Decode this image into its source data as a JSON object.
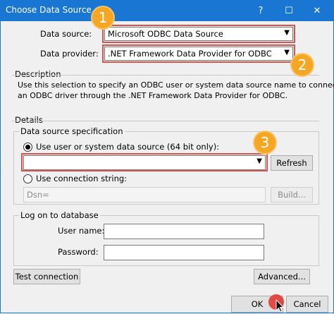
{
  "window": {
    "title": "Choose Data Source",
    "help": "?",
    "maximize": "☐",
    "close": "✕"
  },
  "data_source": {
    "label": "Data source:",
    "value": "Microsoft ODBC Data Source"
  },
  "data_provider": {
    "label": "Data provider:",
    "value": ".NET Framework Data Provider for ODBC"
  },
  "description": {
    "title": "Description",
    "line1": "Use this selection to specify an ODBC user or system data source name to connect to",
    "line2": "an ODBC driver through the .NET Framework Data Provider for ODBC."
  },
  "details": {
    "title": "Details",
    "spec_title": "Data source specification",
    "use_dsn_label": "Use user or system data source (64 bit only):",
    "dsn_value": "",
    "refresh_label": "Refresh",
    "use_conn_label": "Use connection string:",
    "conn_value": "Dsn=",
    "build_label": "Build...",
    "logon_title": "Log on to database",
    "user_label": "User name:",
    "user_value": "",
    "password_label": "Password:",
    "password_value": ""
  },
  "buttons": {
    "test": "Test connection",
    "advanced": "Advanced...",
    "ok": "OK",
    "cancel": "Cancel"
  },
  "callouts": [
    "1",
    "2",
    "3"
  ],
  "colors": {
    "titlebar": "#1976d2",
    "highlight": "#d9534f",
    "callout": "#f5a623"
  }
}
